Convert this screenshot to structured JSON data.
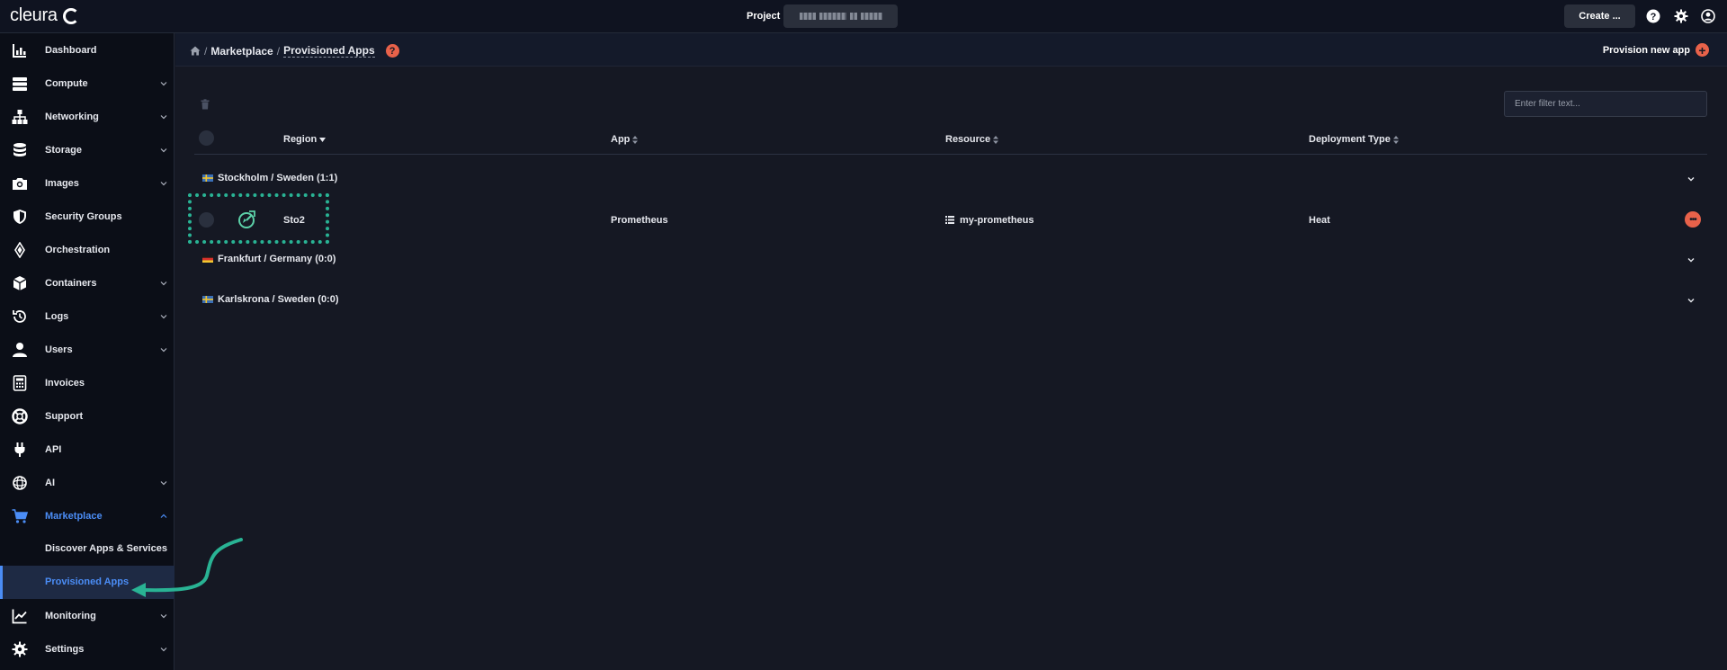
{
  "topbar": {
    "logo_text": "cleura",
    "project_label": "Project",
    "project_value": "",
    "create_label": "Create ...",
    "icons": [
      "help-icon",
      "gear-icon",
      "user-icon"
    ]
  },
  "sidebar": {
    "items": [
      {
        "label": "Dashboard",
        "icon": "dashboard-icon",
        "expandable": false
      },
      {
        "label": "Compute",
        "icon": "compute-icon",
        "expandable": true
      },
      {
        "label": "Networking",
        "icon": "networking-icon",
        "expandable": true
      },
      {
        "label": "Storage",
        "icon": "storage-icon",
        "expandable": true
      },
      {
        "label": "Images",
        "icon": "camera-icon",
        "expandable": true
      },
      {
        "label": "Security Groups",
        "icon": "shield-icon",
        "expandable": false
      },
      {
        "label": "Orchestration",
        "icon": "orchestration-icon",
        "expandable": false
      },
      {
        "label": "Containers",
        "icon": "cube-icon",
        "expandable": true
      },
      {
        "label": "Logs",
        "icon": "history-icon",
        "expandable": true
      },
      {
        "label": "Users",
        "icon": "user-icon",
        "expandable": true
      },
      {
        "label": "Invoices",
        "icon": "calculator-icon",
        "expandable": false
      },
      {
        "label": "Support",
        "icon": "lifebuoy-icon",
        "expandable": false
      },
      {
        "label": "API",
        "icon": "plug-icon",
        "expandable": false
      },
      {
        "label": "AI",
        "icon": "ai-icon",
        "expandable": true
      },
      {
        "label": "Marketplace",
        "icon": "cart-icon",
        "expandable": true
      },
      {
        "label": "Monitoring",
        "icon": "chart-icon",
        "expandable": true
      },
      {
        "label": "Settings",
        "icon": "gear-icon",
        "expandable": true
      }
    ],
    "sub_items": [
      {
        "label": "Discover Apps & Services"
      },
      {
        "label": "Provisioned Apps"
      }
    ],
    "active_color": "#4b8df6"
  },
  "header": {
    "crumb_1": "Marketplace",
    "crumb_2": "Provisioned Apps",
    "provision_label": "Provision new app"
  },
  "filter": {
    "placeholder": "Enter filter text..."
  },
  "table": {
    "columns": [
      "Region",
      "App",
      "Resource",
      "Deployment Type"
    ],
    "groups": [
      {
        "label": "Stockholm / Sweden",
        "count": "(1:1)",
        "flag": "sweden"
      },
      {
        "label": "Frankfurt / Germany",
        "count": "(0:0)",
        "flag": "germany"
      },
      {
        "label": "Karlskrona / Sweden",
        "count": "(0:0)",
        "flag": "sweden"
      }
    ],
    "rows": [
      {
        "region": "Sto2",
        "app": "Prometheus",
        "resource": "my-prometheus",
        "deployment_type": "Heat"
      }
    ]
  },
  "colors": {
    "accent": "#e8624a",
    "highlight": "#29b394",
    "link": "#4b8df6"
  }
}
